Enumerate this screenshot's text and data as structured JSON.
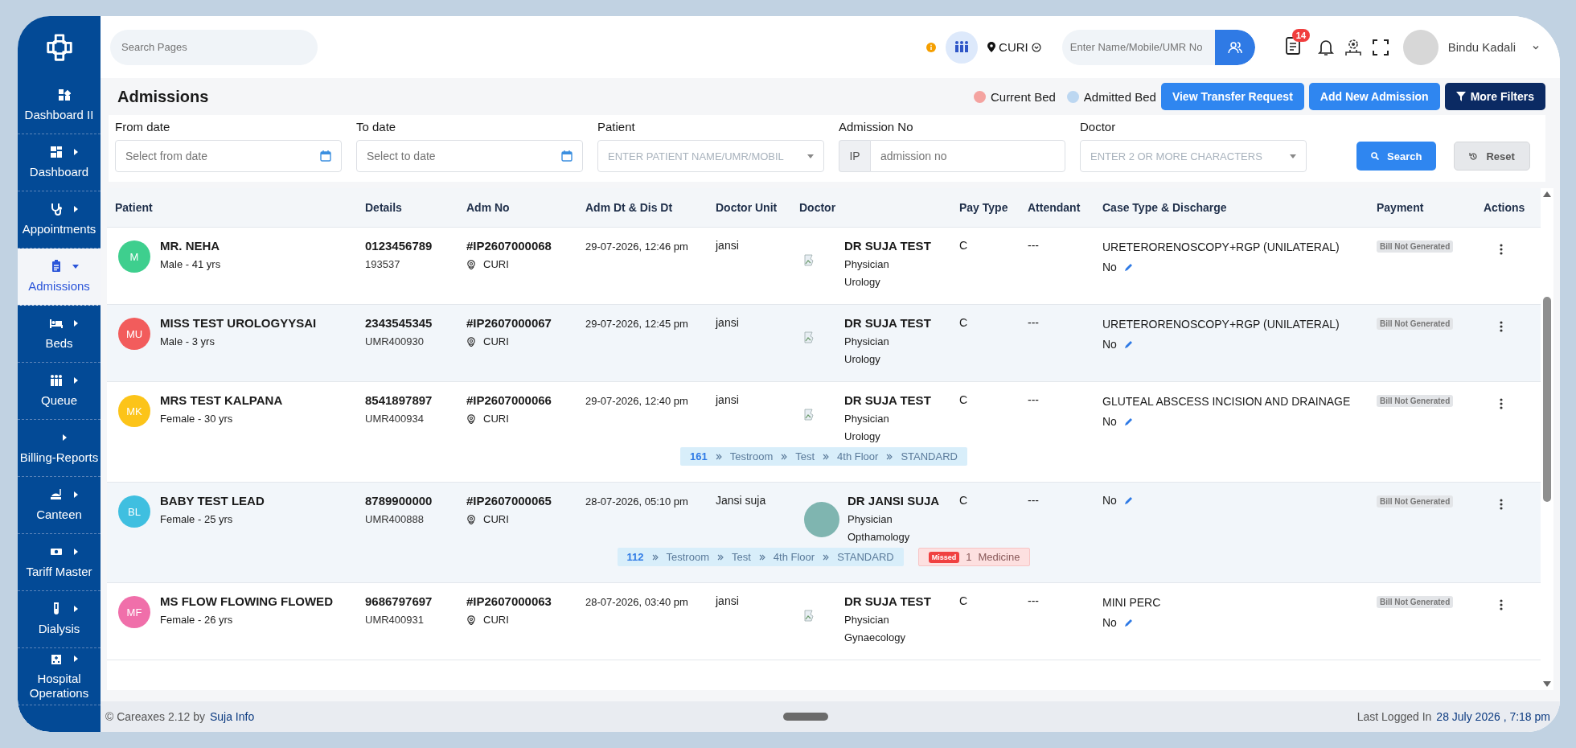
{
  "sidebar": {
    "items": [
      {
        "label": "Dashboard II",
        "submenu": false,
        "selected": false
      },
      {
        "label": "Dashboard",
        "submenu": true,
        "selected": false
      },
      {
        "label": "Appointments",
        "submenu": true,
        "selected": false
      },
      {
        "label": "Admissions",
        "submenu": true,
        "selected": true
      },
      {
        "label": "Beds",
        "submenu": true,
        "selected": false
      },
      {
        "label": "Queue",
        "submenu": true,
        "selected": false
      },
      {
        "label": "Billing-Reports",
        "submenu": true,
        "selected": false
      },
      {
        "label": "Canteen",
        "submenu": true,
        "selected": false
      },
      {
        "label": "Tariff Master",
        "submenu": true,
        "selected": false
      },
      {
        "label": "Dialysis",
        "submenu": true,
        "selected": false
      },
      {
        "label": "Hospital Operations",
        "submenu": true,
        "selected": false
      }
    ]
  },
  "topbar": {
    "search": {
      "placeholder": "Search Pages"
    },
    "location": "CURI",
    "patient_search": {
      "placeholder": "Enter Name/Mobile/UMR No"
    },
    "notification_count": "14",
    "user": {
      "name": "Bindu Kadali"
    }
  },
  "page": {
    "title": "Admissions",
    "legend": [
      {
        "label": "Current Bed",
        "color": "#f4a3a0"
      },
      {
        "label": "Admitted Bed",
        "color": "#bcd7f1"
      }
    ],
    "buttons": [
      {
        "label": "View Transfer Request",
        "kind": "primary"
      },
      {
        "label": "Add New Admission",
        "kind": "primary"
      },
      {
        "label": "More Filters",
        "kind": "dark"
      }
    ]
  },
  "filters": [
    {
      "label": "From date",
      "kind": "date",
      "placeholder": "Select from date"
    },
    {
      "label": "To date",
      "kind": "date",
      "placeholder": "Select to date"
    },
    {
      "label": "Patient",
      "kind": "select",
      "placeholder": "ENTER PATIENT NAME/UMR/MOBIL"
    },
    {
      "label": "Admission No",
      "kind": "prefixed",
      "prefix": "IP",
      "placeholder": "admission no"
    },
    {
      "label": "Doctor",
      "kind": "select",
      "placeholder": "ENTER 2 OR MORE CHARACTERS"
    }
  ],
  "filter_actions": [
    {
      "label": "Search",
      "kind": "primary"
    },
    {
      "label": "Reset",
      "kind": "secondary"
    }
  ],
  "table": {
    "columns": [
      "Patient",
      "Details",
      "Adm No",
      "Adm Dt & Dis Dt",
      "Doctor Unit",
      "Doctor",
      "Pay Type",
      "Attendant",
      "Case Type & Discharge",
      "Payment",
      "Actions"
    ],
    "rows": [
      {
        "initials": "M",
        "color": "#3ecf8e",
        "name": "MR. NEHA",
        "gender_age": "Male - 41 yrs",
        "phone": "0123456789",
        "umr": "193537",
        "adm_no": "#IP2607000068",
        "location": "CURI",
        "adm_date": "29-07-2026, 12:46 pm",
        "doctor_unit": "jansi",
        "doctor": {
          "name": "DR SUJA TEST",
          "role": "Physician",
          "department": "Urology",
          "has_photo": false
        },
        "pay_type": "C",
        "attendant": "---",
        "case_type": "URETERORENOSCOPY+RGP (UNILATERAL)",
        "discharge": "No",
        "payment": "Bill Not Generated"
      },
      {
        "initials": "MU",
        "color": "#f25c5c",
        "name": "MISS TEST UROLOGYYSAI",
        "gender_age": "Male - 3 yrs",
        "phone": "2343545345",
        "umr": "UMR400930",
        "adm_no": "#IP2607000067",
        "location": "CURI",
        "adm_date": "29-07-2026, 12:45 pm",
        "doctor_unit": "jansi",
        "doctor": {
          "name": "DR SUJA TEST",
          "role": "Physician",
          "department": "Urology",
          "has_photo": false
        },
        "pay_type": "C",
        "attendant": "---",
        "case_type": "URETERORENOSCOPY+RGP (UNILATERAL)",
        "discharge": "No",
        "payment": "Bill Not Generated"
      },
      {
        "initials": "MK",
        "color": "#fcc419",
        "name": "MRS TEST KALPANA",
        "gender_age": "Female - 30 yrs",
        "phone": "8541897897",
        "umr": "UMR400934",
        "adm_no": "#IP2607000066",
        "location": "CURI",
        "adm_date": "29-07-2026, 12:40 pm",
        "doctor_unit": "jansi",
        "doctor": {
          "name": "DR SUJA TEST",
          "role": "Physician",
          "department": "Urology",
          "has_photo": false
        },
        "pay_type": "C",
        "attendant": "---",
        "case_type": "GLUTEAL ABSCESS INCISION AND DRAINAGE",
        "discharge": "No",
        "payment": "Bill Not Generated",
        "bed": [
          "161",
          "Testroom",
          "Test",
          "4th Floor",
          "STANDARD"
        ]
      },
      {
        "initials": "BL",
        "color": "#3fbfe0",
        "name": "BABY TEST LEAD",
        "gender_age": "Female - 25 yrs",
        "phone": "8789900000",
        "umr": "UMR400888",
        "adm_no": "#IP2607000065",
        "location": "CURI",
        "adm_date": "28-07-2026, 05:10 pm",
        "doctor_unit": "Jansi suja",
        "doctor": {
          "name": "DR JANSI SUJA",
          "role": "Physician",
          "department": "Opthamology",
          "has_photo": true
        },
        "pay_type": "C",
        "attendant": "---",
        "discharge": "No",
        "payment": "Bill Not Generated",
        "bed": [
          "112",
          "Testroom",
          "Test",
          "4th Floor",
          "STANDARD"
        ],
        "missed": {
          "badge": "Missed",
          "count": "1",
          "label": "Medicine"
        }
      },
      {
        "initials": "MF",
        "color": "#f06faa",
        "name": "MS FLOW FLOWING FLOWED",
        "gender_age": "Female - 26 yrs",
        "phone": "9686797697",
        "umr": "UMR400931",
        "adm_no": "#IP2607000063",
        "location": "CURI",
        "adm_date": "28-07-2026, 03:40 pm",
        "doctor_unit": "jansi",
        "doctor": {
          "name": "DR SUJA TEST",
          "role": "Physician",
          "department": "Gynaecology",
          "has_photo": false
        },
        "pay_type": "C",
        "attendant": "---",
        "case_type": "MINI PERC",
        "discharge": "No",
        "payment": "Bill Not Generated"
      }
    ]
  },
  "footer": {
    "copyright": "© Careaxes 2.12 by",
    "company": "Suja Info",
    "last_login_label": "Last Logged In",
    "last_login": "28 July 2026 , 7:18 pm"
  }
}
